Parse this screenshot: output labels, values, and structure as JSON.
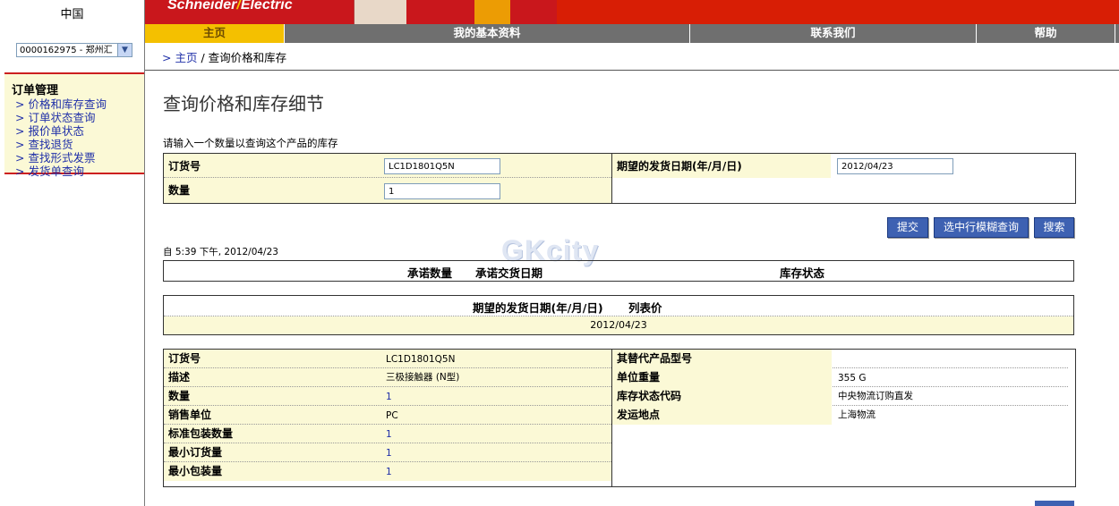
{
  "sidebar": {
    "country": "中国",
    "account_select": "0000162975 - 郑州汇",
    "section_title": "订单管理",
    "items": [
      {
        "label": "> 价格和库存查询"
      },
      {
        "label": "> 订单状态查询"
      },
      {
        "label": "> 报价单状态"
      },
      {
        "label": "> 查找退货"
      },
      {
        "label": "> 查找形式发票"
      },
      {
        "label": "> 发货单查询"
      }
    ]
  },
  "header": {
    "logo_left": "Schneider",
    "logo_slash": "/",
    "logo_right": "Electric",
    "tabs": [
      {
        "label": "主页"
      },
      {
        "label": "我的基本资料"
      },
      {
        "label": "联系我们"
      },
      {
        "label": "帮助"
      }
    ]
  },
  "breadcrumb": {
    "prefix": "> ",
    "home": "主页",
    "sep": " / ",
    "current": "查询价格和库存"
  },
  "page": {
    "title": "查询价格和库存细节",
    "instruction": "请输入一个数量以查询这个产品的库存"
  },
  "form": {
    "order_no_label": "订货号",
    "order_no_value": "LC1D1801Q5N",
    "qty_label": "数量",
    "qty_value": "1",
    "date_label": "期望的发货日期(年/月/日)",
    "date_value": "2012/04/23"
  },
  "buttons": {
    "submit": "提交",
    "fuzzy": "选中行模糊查询",
    "search": "搜索"
  },
  "as_of": "自 5:39 下午, 2012/04/23",
  "watermark": "GKcity",
  "availability": {
    "col_qty": "承诺数量",
    "col_date": "承诺交货日期",
    "col_stock": "库存状态"
  },
  "pricebox": {
    "col_date": "期望的发货日期(年/月/日)",
    "col_price": "列表价",
    "date_value": "2012/04/23"
  },
  "details": {
    "left": [
      {
        "label": "订货号",
        "value": "LC1D1801Q5N"
      },
      {
        "label": "描述",
        "value": "三极接触器 (N型)"
      },
      {
        "label": "数量",
        "value": "1"
      },
      {
        "label": "销售单位",
        "value": "PC"
      },
      {
        "label": "标准包装数量",
        "value": "1"
      },
      {
        "label": "最小订货量",
        "value": "1"
      },
      {
        "label": "最小包装量",
        "value": "1"
      }
    ],
    "right": [
      {
        "label": "其替代产品型号",
        "value": ""
      },
      {
        "label": "单位重量",
        "value": "355 G"
      },
      {
        "label": "库存状态代码",
        "value": "中央物流订购直发"
      },
      {
        "label": "发运地点",
        "value": "上海物流"
      }
    ]
  }
}
